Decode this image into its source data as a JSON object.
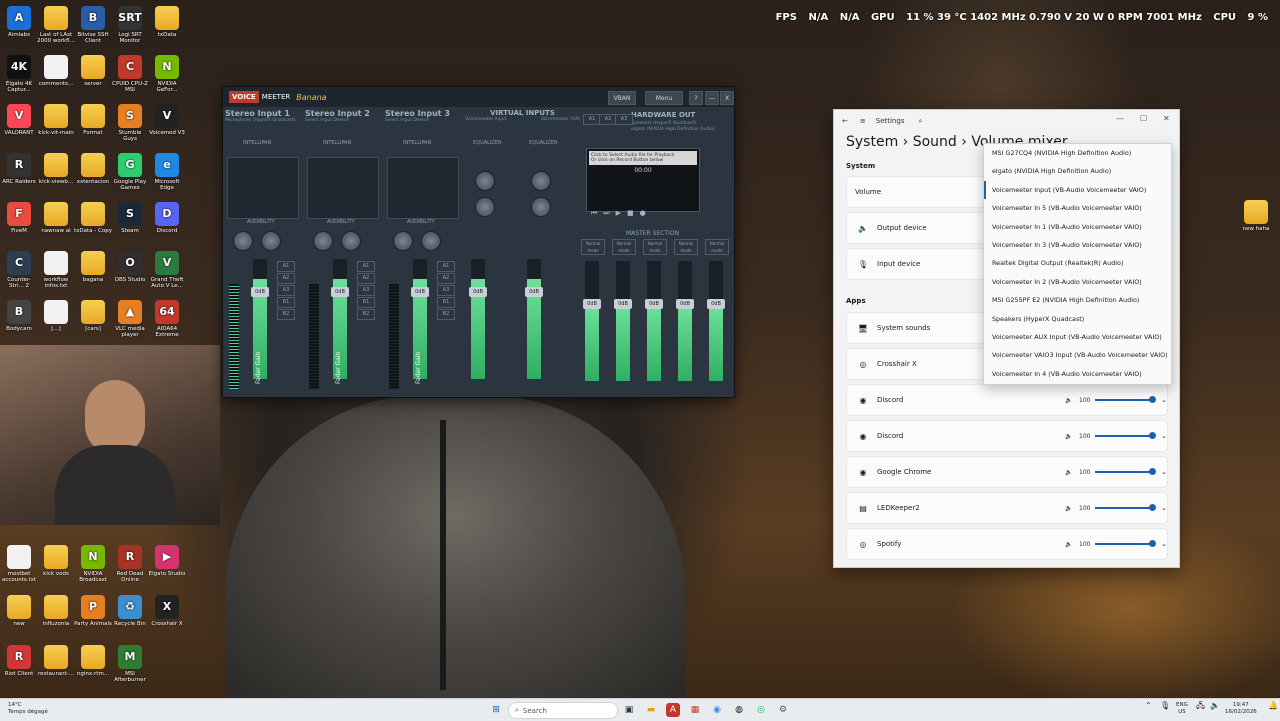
{
  "overlay": {
    "fps_label": "FPS",
    "fps_val1": "N/A",
    "fps_val2": "N/A",
    "gpu_label": "GPU",
    "gpu_stats": "11 % 39 °C 1402 MHz 0.790 V 20 W 0 RPM 7001 MHz",
    "cpu_label": "CPU",
    "cpu_stats": "9 %"
  },
  "desktop_icons": [
    {
      "label": "Aimlabs",
      "glyph": "A",
      "color": "#1a6fd8"
    },
    {
      "label": "Last of LAst 2000 workfl...",
      "glyph": "",
      "kind": "folder"
    },
    {
      "label": "Bitvise SSH Client",
      "glyph": "B",
      "color": "#2a5ca8"
    },
    {
      "label": "Logi SRT Monitor",
      "glyph": "SRT",
      "color": "#333"
    },
    {
      "label": "txData",
      "glyph": "",
      "kind": "folder"
    },
    {
      "label": "Elgato 4K Captur...",
      "glyph": "4K",
      "color": "#111"
    },
    {
      "label": "comments...",
      "glyph": "",
      "kind": "file"
    },
    {
      "label": "server",
      "glyph": "",
      "kind": "folder"
    },
    {
      "label": "CPUID CPU-Z MSI",
      "glyph": "C",
      "color": "#c0392b"
    },
    {
      "label": "NVIDIA GeFor...",
      "glyph": "N",
      "color": "#76b900"
    },
    {
      "label": "VALORANT",
      "glyph": "V",
      "color": "#ff4655"
    },
    {
      "label": "kick-vit-main",
      "glyph": "",
      "kind": "folder"
    },
    {
      "label": "Format",
      "glyph": "",
      "kind": "folder"
    },
    {
      "label": "Stumble Guys",
      "glyph": "S",
      "color": "#e67e22"
    },
    {
      "label": "Voicemod V3",
      "glyph": "V",
      "color": "#222"
    },
    {
      "label": "ARC Raiders",
      "glyph": "R",
      "color": "#333"
    },
    {
      "label": "kick-viewb...",
      "glyph": "",
      "kind": "folder"
    },
    {
      "label": "xxtentacion",
      "glyph": "",
      "kind": "folder"
    },
    {
      "label": "Google Play Games",
      "glyph": "G",
      "color": "#2ecc71"
    },
    {
      "label": "Microsoft Edge",
      "glyph": "e",
      "color": "#1e88e5"
    },
    {
      "label": "FiveM",
      "glyph": "F",
      "color": "#e74c3c"
    },
    {
      "label": "nawnaw ai",
      "glyph": "",
      "kind": "folder"
    },
    {
      "label": "txData - Copy",
      "glyph": "",
      "kind": "folder"
    },
    {
      "label": "Steam",
      "glyph": "S",
      "color": "#1b2838"
    },
    {
      "label": "Discord",
      "glyph": "D",
      "color": "#5865f2"
    },
    {
      "label": "Counter-Stri... 2",
      "glyph": "C",
      "color": "#2c3e50"
    },
    {
      "label": "workflow infos.txt",
      "glyph": "",
      "kind": "file"
    },
    {
      "label": "bagana",
      "glyph": "",
      "kind": "folder"
    },
    {
      "label": "OBS Studio",
      "glyph": "O",
      "color": "#302e31"
    },
    {
      "label": "Grand Theft Auto V Le...",
      "glyph": "V",
      "color": "#2d7a3e"
    },
    {
      "label": "Bodycam",
      "glyph": "B",
      "color": "#444"
    },
    {
      "label": "[...]",
      "glyph": "",
      "kind": "file"
    },
    {
      "label": "[cars]",
      "glyph": "",
      "kind": "folder"
    },
    {
      "label": "VLC media player",
      "glyph": "▲",
      "color": "#e67e22"
    },
    {
      "label": "AIDA64 Extreme",
      "glyph": "64",
      "color": "#c0392b"
    }
  ],
  "desktop_icons_bottom": [
    {
      "label": "mostbet accounts.txt",
      "glyph": "",
      "kind": "file"
    },
    {
      "label": "kick vods",
      "glyph": "",
      "kind": "folder"
    },
    {
      "label": "NVIDIA Broadcast",
      "glyph": "N",
      "color": "#76b900"
    },
    {
      "label": "Red Dead Online",
      "glyph": "R",
      "color": "#a93226"
    },
    {
      "label": "Elgato Studio",
      "glyph": "▶",
      "color": "#d6336c"
    },
    {
      "label": "new",
      "glyph": "",
      "kind": "folder"
    },
    {
      "label": "influzonia",
      "glyph": "",
      "kind": "folder"
    },
    {
      "label": "Party Animals",
      "glyph": "P",
      "color": "#e67e22"
    },
    {
      "label": "Recycle Bin",
      "glyph": "♻",
      "color": "#3b8ed0"
    },
    {
      "label": "Crosshair X",
      "glyph": "X",
      "color": "#222"
    },
    {
      "label": "Riot Client",
      "glyph": "R",
      "color": "#d13639"
    },
    {
      "label": "restaurant-...",
      "glyph": "",
      "kind": "folder"
    },
    {
      "label": "nginx-rtm...",
      "glyph": "",
      "kind": "folder"
    },
    {
      "label": "MSI Afterburner",
      "glyph": "M",
      "color": "#2e7d32"
    }
  ],
  "desktop_icon_right": {
    "label": "new haha"
  },
  "voicemeeter": {
    "logo_voice": "VOICE",
    "logo_meeter": "MEETER",
    "logo_banana": "Banana",
    "vban": "VBAN",
    "menu": "Menu",
    "help": "?",
    "minimize": "—",
    "close": "X",
    "strips": [
      {
        "name": "Stereo Input 1",
        "sub": "Microphone (HyperX Quadcast)",
        "intelli": "INTELLIPAN",
        "audibility": "AUDIBILITY",
        "gain": "0dB",
        "fader": "Fader Gain"
      },
      {
        "name": "Stereo Input 2",
        "sub": "Select Input Device",
        "intelli": "INTELLIPAN",
        "audibility": "AUDIBILITY",
        "gain": "0dB",
        "fader": "Fader Gain"
      },
      {
        "name": "Stereo Input 3",
        "sub": "Select Input Device",
        "intelli": "INTELLIPAN",
        "audibility": "AUDIBILITY",
        "gain": "0dB",
        "fader": "Fader Gain"
      }
    ],
    "virtual_inputs": "VIRTUAL INPUTS",
    "vi1": "Voicemeeter Input",
    "vi2": "Voicemeeter AUX",
    "equalizer": "EQUALIZER",
    "hw_out": "HARDWARE OUT",
    "hw_out_sub": "Speakers (HyperX Quadcast)",
    "hw_out_sub2": "elgato (NVIDIA High Definition Audio)",
    "cassette_text": "Click to Select Audio file for Playback",
    "cassette_sub": "Or click on Record Button below",
    "cassette_time": "00:00",
    "master_section": "MASTER SECTION",
    "normal_mode": "Normal mode",
    "gain": "0dB",
    "fader": "Fader Gain",
    "bus_a1": "A1",
    "bus_a2": "A2",
    "bus_a3": "A3",
    "bus_b1": "B1",
    "bus_b2": "B2"
  },
  "settings": {
    "app_title": "Settings",
    "breadcrumb_system": "System",
    "breadcrumb_sound": "Sound",
    "breadcrumb_page": "Volume mixer",
    "section_system": "System",
    "volume_label": "Volume",
    "output_device": "Output device",
    "input_device": "Input device",
    "section_apps": "Apps",
    "apps": [
      {
        "name": "System sounds",
        "show_slider": false
      },
      {
        "name": "Crosshair X",
        "show_slider": false
      },
      {
        "name": "Discord",
        "volume": "100",
        "show_slider": true
      },
      {
        "name": "Discord",
        "volume": "100",
        "show_slider": true
      },
      {
        "name": "Google Chrome",
        "volume": "100",
        "show_slider": true
      },
      {
        "name": "LEDKeeper2",
        "volume": "100",
        "show_slider": true
      },
      {
        "name": "Spotify",
        "volume": "100",
        "show_slider": true
      }
    ],
    "dropdown_items": [
      "MSI G27CQ4 (NVIDIA High Definition Audio)",
      "elgato (NVIDIA High Definition Audio)",
      "Voicemeeter Input (VB-Audio Voicemeeter VAIO)",
      "Voicemeeter In 5 (VB-Audio Voicemeeter VAIO)",
      "Voicemeeter In 1 (VB-Audio Voicemeeter VAIO)",
      "Voicemeeter In 3 (VB-Audio Voicemeeter VAIO)",
      "Realtek Digital Output (Realtek(R) Audio)",
      "Voicemeeter In 2 (VB-Audio Voicemeeter VAIO)",
      "MSI G255PF E2 (NVIDIA High Definition Audio)",
      "Speakers (HyperX Quadcast)",
      "Voicemeeter AUX Input (VB-Audio Voicemeeter VAIO)",
      "Voicemeeter VAIO3 Input (VB-Audio Voicemeeter VAIO)",
      "Voicemeeter In 4 (VB-Audio Voicemeeter VAIO)"
    ],
    "dropdown_selected_index": 2
  },
  "taskbar": {
    "weather_temp": "14°C",
    "weather_desc": "Temps dégagé",
    "search_placeholder": "Search",
    "lang1": "ENG",
    "lang2": "US",
    "time": "19:47",
    "date": "16/02/2026"
  }
}
